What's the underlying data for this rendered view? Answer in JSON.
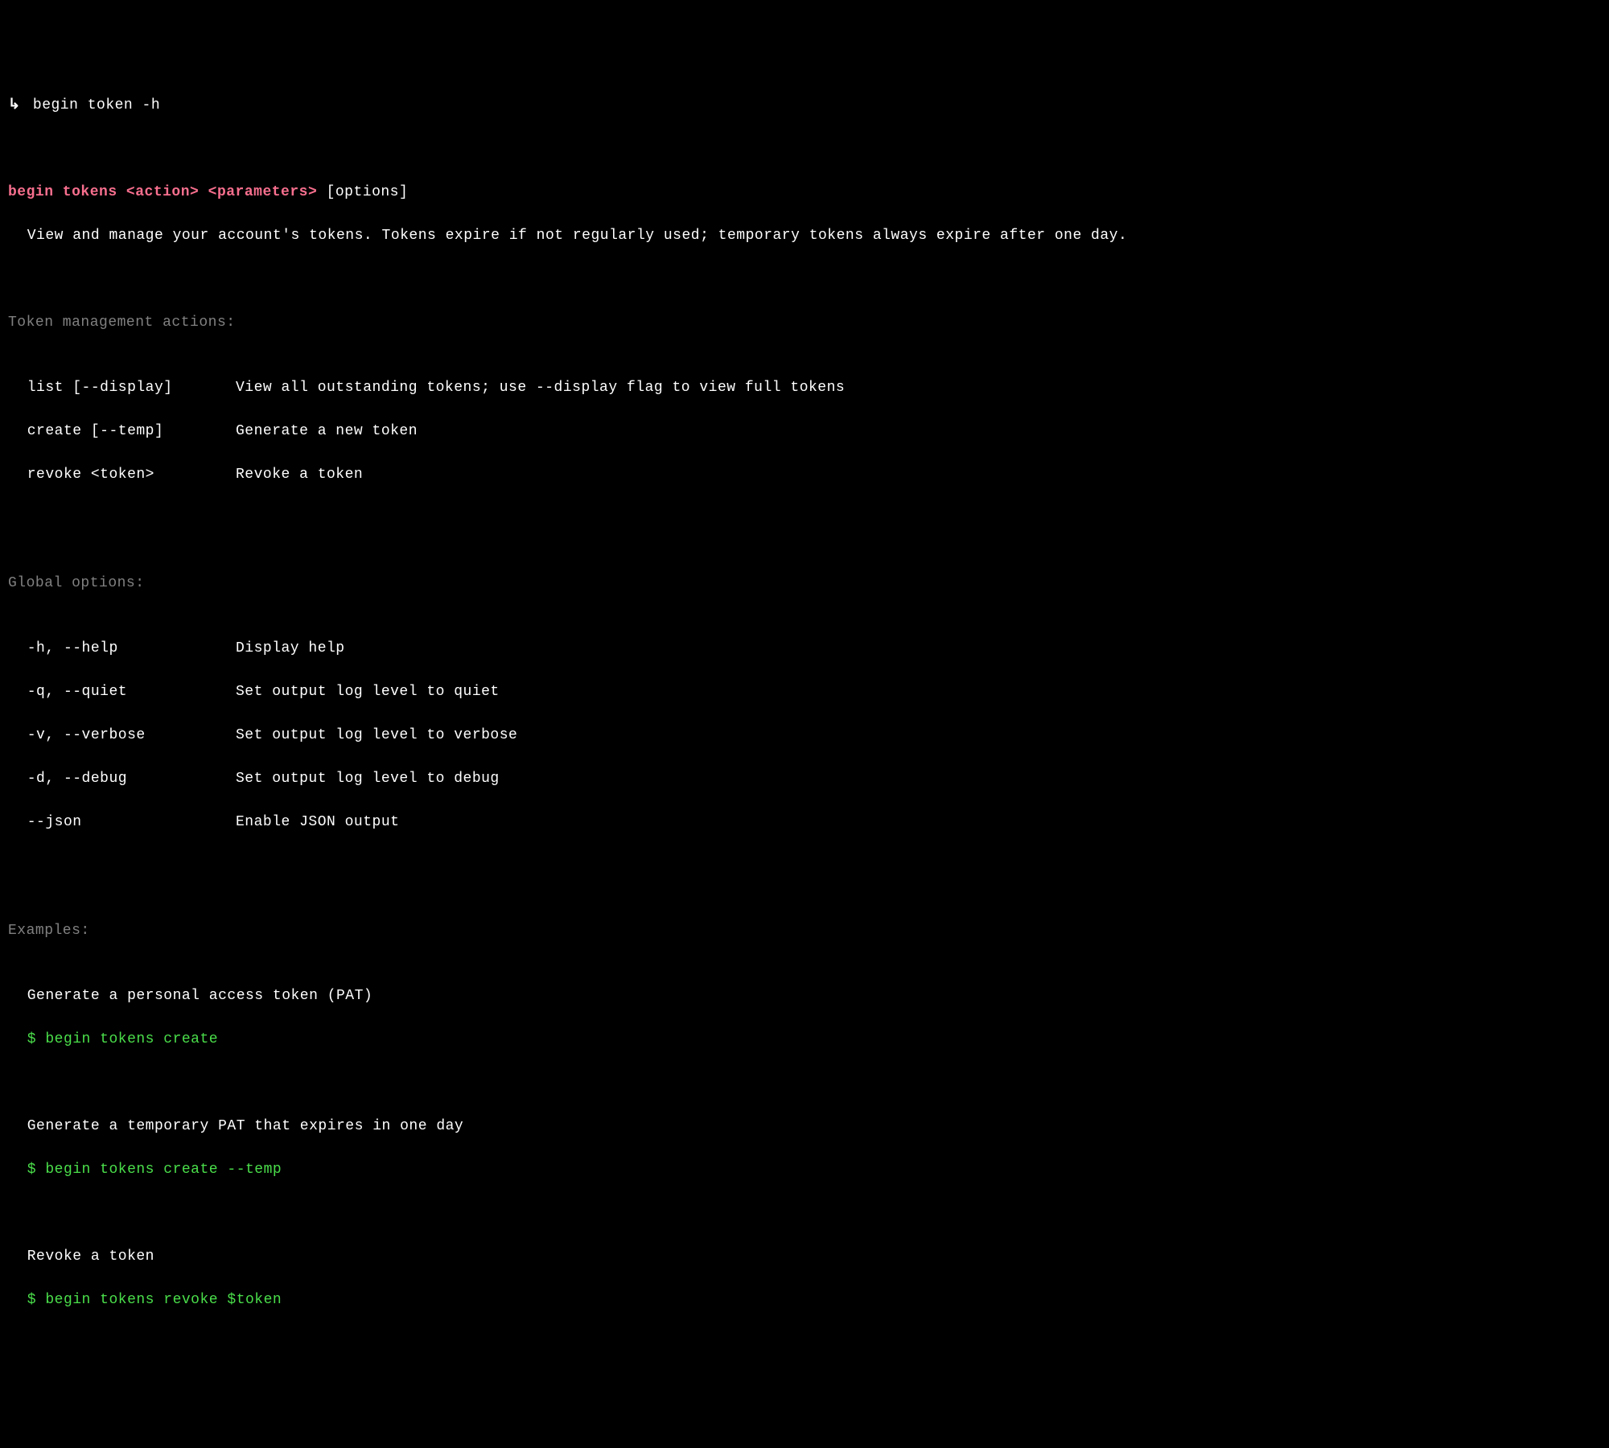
{
  "prompt": {
    "arrow": "↳",
    "command": "begin token -h"
  },
  "usage": {
    "pink": "begin tokens <action> <parameters>",
    "options": " [options]",
    "description": "View and manage your account's tokens. Tokens expire if not regularly used; temporary tokens always expire after one day."
  },
  "actions": {
    "header": "Token management actions:",
    "items": [
      {
        "cmd": "list [--display]",
        "desc": "View all outstanding tokens; use --display flag to view full tokens"
      },
      {
        "cmd": "create [--temp]",
        "desc": "Generate a new token"
      },
      {
        "cmd": "revoke <token>",
        "desc": "Revoke a token"
      }
    ]
  },
  "global": {
    "header": "Global options:",
    "items": [
      {
        "flag": "-h, --help",
        "desc": "Display help"
      },
      {
        "flag": "-q, --quiet",
        "desc": "Set output log level to quiet"
      },
      {
        "flag": "-v, --verbose",
        "desc": "Set output log level to verbose"
      },
      {
        "flag": "-d, --debug",
        "desc": "Set output log level to debug"
      },
      {
        "flag": "--json",
        "desc": "Enable JSON output"
      }
    ]
  },
  "examples": {
    "header": "Examples:",
    "items": [
      {
        "desc": "Generate a personal access token (PAT)",
        "cmd": "$ begin tokens create"
      },
      {
        "desc": "Generate a temporary PAT that expires in one day",
        "cmd": "$ begin tokens create --temp"
      },
      {
        "desc": "Revoke a token",
        "cmd": "$ begin tokens revoke $token"
      }
    ]
  }
}
